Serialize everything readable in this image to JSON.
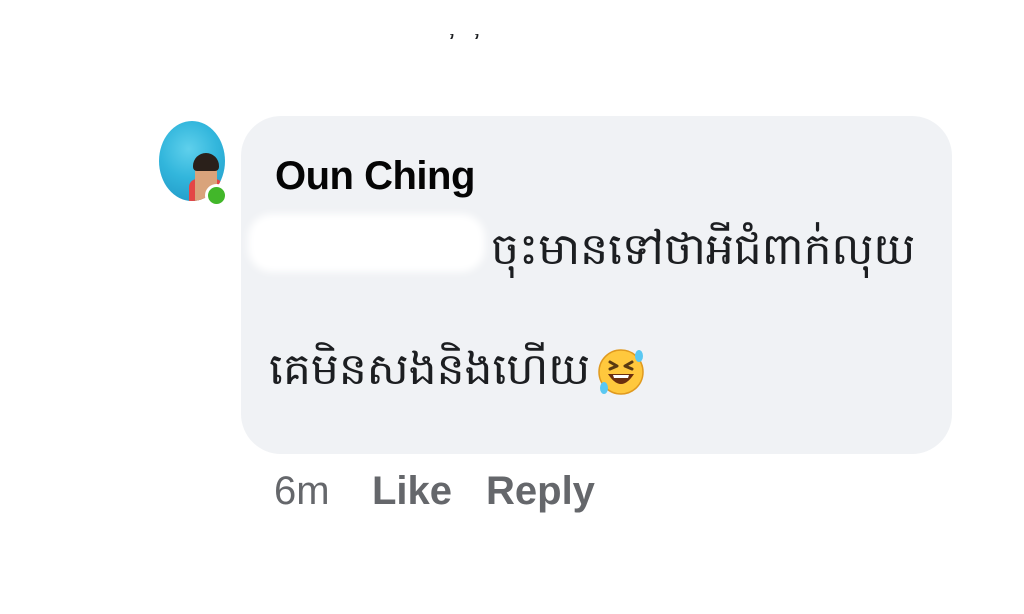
{
  "comment": {
    "author": "Oun Ching",
    "text_line1": "ចុះមានទៅថាអីជំពាក់លុយ",
    "text_line2": "គេមិនសងនិងហើយ",
    "emoji": "rolling-on-floor-laughing",
    "timestamp": "6m",
    "like_label": "Like",
    "reply_label": "Reply",
    "online": true
  },
  "colors": {
    "bubble_bg": "#f0f2f5",
    "text": "#1c1e21",
    "meta_text": "#65676b",
    "online_dot": "#42b72a",
    "avatar_bg": "#32b6dc"
  }
}
